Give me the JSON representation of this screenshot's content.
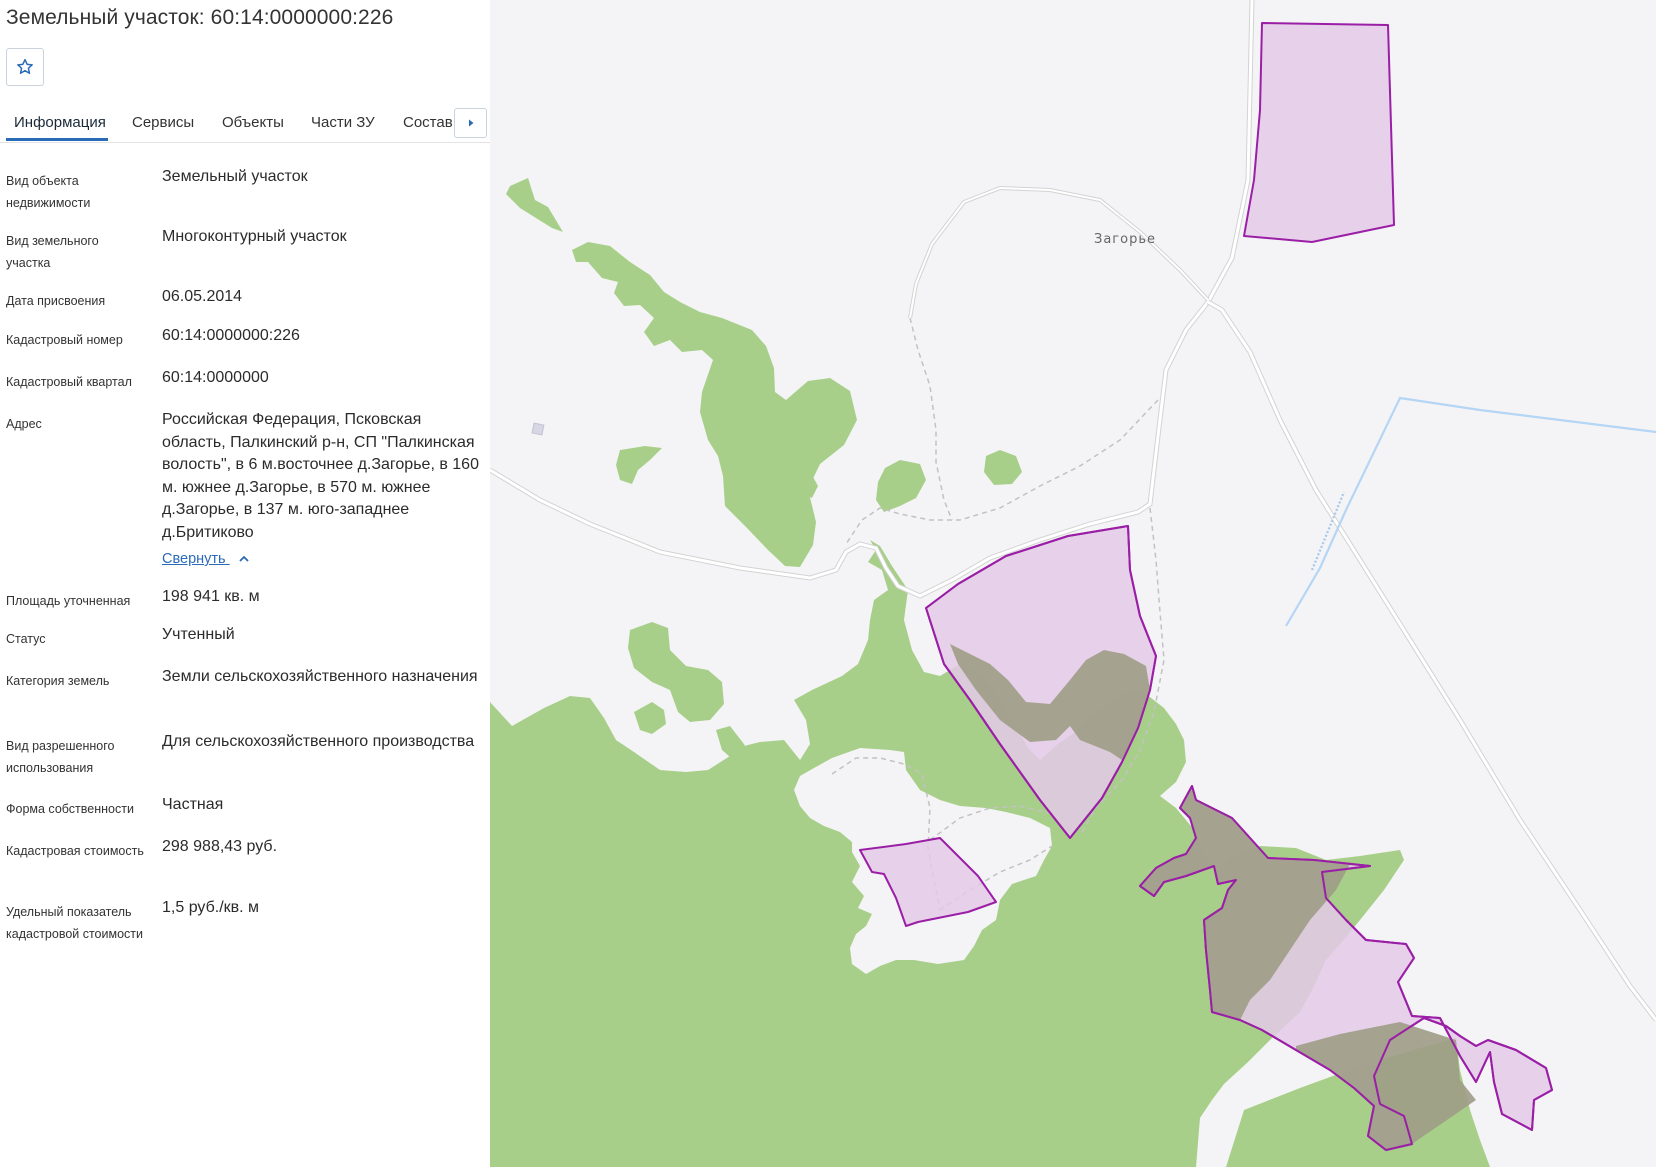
{
  "header": {
    "title": "Земельный участок: 60:14:0000000:226"
  },
  "tabs": [
    {
      "label": "Информация",
      "active": true
    },
    {
      "label": "Сервисы",
      "active": false
    },
    {
      "label": "Объекты",
      "active": false
    },
    {
      "label": "Части ЗУ",
      "active": false
    },
    {
      "label": "Состав",
      "active": false
    }
  ],
  "info": {
    "object_type": {
      "label": "Вид объекта недвижимости",
      "value": "Земельный участок"
    },
    "land_type": {
      "label": "Вид земельного участка",
      "value": "Многоконтурный участок"
    },
    "assign_date": {
      "label": "Дата присвоения",
      "value": "06.05.2014"
    },
    "cadastral_number": {
      "label": "Кадастровый номер",
      "value": "60:14:0000000:226"
    },
    "cadastral_quarter": {
      "label": "Кадастровый квартал",
      "value": "60:14:0000000"
    },
    "address": {
      "label": "Адрес",
      "value": "Российская Федерация, Псковская область, Палкинский р-н, СП \"Палкинская волость\", в 6 м.восточнее д.Загорье, в 160 м. южнее д.Загорье, в 570 м. южнее д.Загорье, в 137 м. юго-западнее д.Бритиково"
    },
    "collapse_link": "Свернуть",
    "area": {
      "label": "Площадь уточненная",
      "value": "198 941 кв. м"
    },
    "status": {
      "label": "Статус",
      "value": "Учтенный"
    },
    "category": {
      "label": "Категория земель",
      "value": "Земли сельскохозяйственного назначения"
    },
    "permitted_use": {
      "label": "Вид разрешенного использования",
      "value": "Для сельскохозяйственного производства"
    },
    "ownership": {
      "label": "Форма собственности",
      "value": "Частная"
    },
    "cadastral_value": {
      "label": "Кадастровая стоимость",
      "value": "298 988,43 руб."
    },
    "unit_value": {
      "label": "Удельный показатель кадастровой стоимости",
      "value": "1,5 руб./кв. м"
    }
  },
  "map": {
    "place_label": "Загорье",
    "colors": {
      "background": "#f4f4f6",
      "forest": "#a8cf8a",
      "parcel_fill": "#e4c9e6",
      "parcel_overlap": "#9e9c86",
      "parcel_stroke": "#9a1fa6",
      "road": "#d8d8d8",
      "water": "#b5d5f5",
      "accent": "#2a6bb7"
    },
    "icons": [
      "star-icon",
      "chevron-right-icon",
      "chevron-up-icon"
    ]
  }
}
